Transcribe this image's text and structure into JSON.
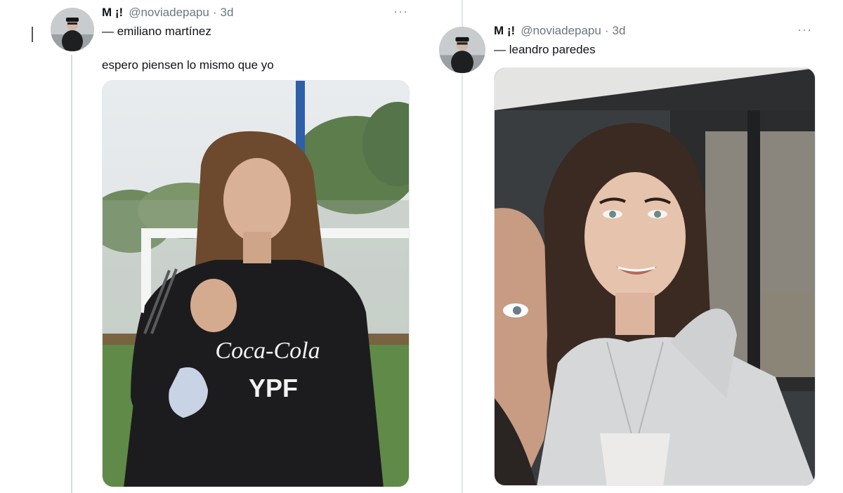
{
  "tweets": [
    {
      "author": {
        "name": "M ¡!",
        "handle": "@noviadepapu"
      },
      "separator": "·",
      "time": "3d",
      "more_icon": "more-horizontal-icon",
      "reply_line": "— emiliano martínez",
      "text": "espero piensen lo mismo que yo",
      "photo_text": {
        "brand": "Coca-Cola",
        "sponsor": "YPF"
      }
    },
    {
      "author": {
        "name": "M ¡!",
        "handle": "@noviadepapu"
      },
      "separator": "·",
      "time": "3d",
      "more_icon": "more-horizontal-icon",
      "reply_line": "— leandro paredes"
    }
  ],
  "colors": {
    "handle": "#6b7780",
    "divider": "#e3e6e8",
    "text": "#0f1419"
  }
}
